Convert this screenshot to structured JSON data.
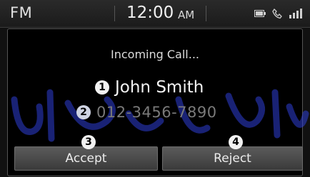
{
  "status_bar": {
    "source": "FM",
    "time": "12:00",
    "ampm": "AM",
    "icons": [
      "battery-icon",
      "phone-handset-icon",
      "signal-strength-icon"
    ]
  },
  "call": {
    "heading": "Incoming Call...",
    "caller_name": "John Smith",
    "caller_number": "012-3456-7890"
  },
  "callouts": {
    "name": "1",
    "number": "2",
    "accept": "3",
    "reject": "4"
  },
  "buttons": {
    "accept": "Accept",
    "reject": "Reject"
  },
  "colors": {
    "watermark": "#2e3fd6",
    "background": "#000000",
    "button": "#4a4a4a"
  }
}
